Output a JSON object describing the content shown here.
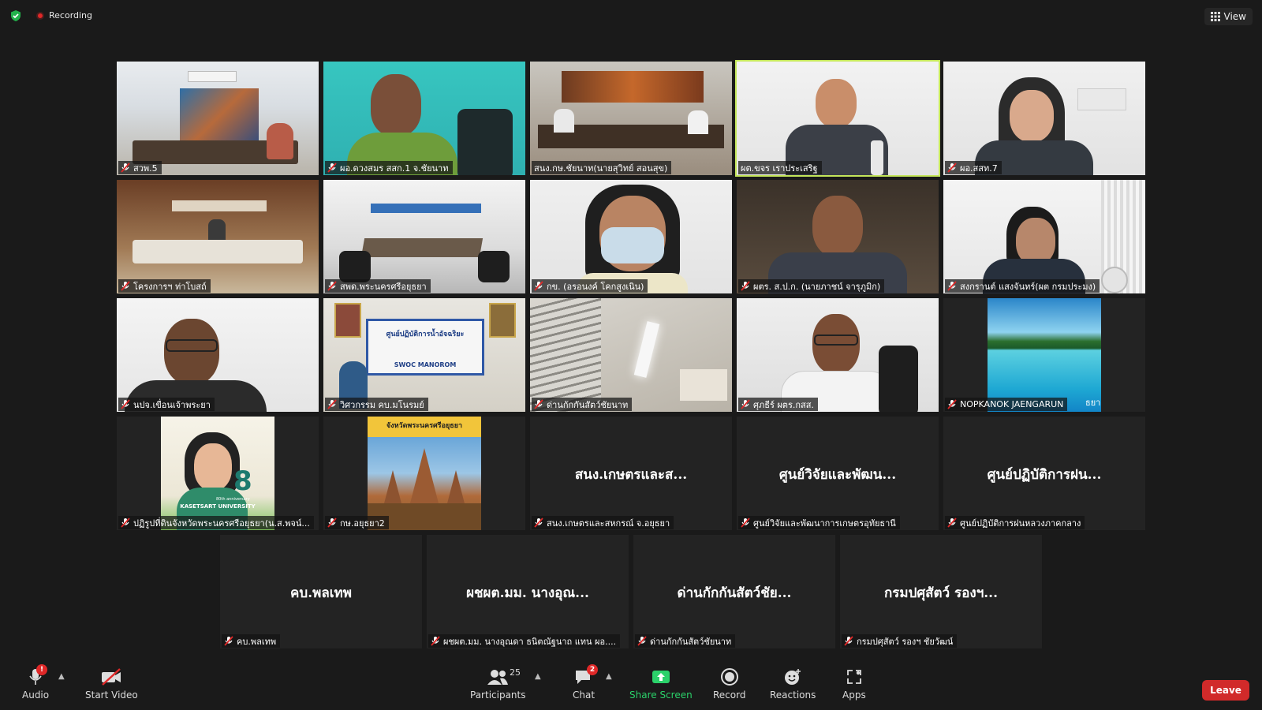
{
  "topbar": {
    "recording_label": "Recording",
    "view_label": "View"
  },
  "participants": [
    {
      "name": "สวพ.5",
      "video": true,
      "active": false
    },
    {
      "name": "ผอ.ดวงสมร สสก.1 จ.ชัยนาท",
      "video": true,
      "active": false
    },
    {
      "name": "สนง.กษ.ชัยนาท(นายสุวิทย์ สอนสุข)",
      "video": true,
      "active": false
    },
    {
      "name": "ผต.ขจร เราประเสริฐ",
      "video": true,
      "active": true
    },
    {
      "name": "ผอ.สสท.7",
      "video": true,
      "active": false
    },
    {
      "name": "โครงการฯ ท่าโบสถ์",
      "video": true,
      "active": false
    },
    {
      "name": "สพด.พระนครศรีอยุธยา",
      "video": true,
      "active": false
    },
    {
      "name": "กข. (อรอนงค์ โคกสูงเนิน)",
      "video": true,
      "active": false
    },
    {
      "name": "ผตร. ส.ป.ก. (นายภาชน์ จารุภูมิก)",
      "video": true,
      "active": false
    },
    {
      "name": "สงกรานต์ แสงจันทร์(ผต กรมประมง)",
      "video": true,
      "active": false
    },
    {
      "name": "นปจ.เขื่อนเจ้าพระยา",
      "video": true,
      "active": false
    },
    {
      "name": "วิศวกรรม คบ.มโนรมย์",
      "video": true,
      "active": false
    },
    {
      "name": "ด่านกักกันสัตว์ชัยนาท",
      "video": true,
      "active": false
    },
    {
      "name": "ศุภธีร์ ผตร.กสส.",
      "video": true,
      "active": false
    },
    {
      "name": "NOPKANOK JAENGARUN",
      "video": true,
      "active": false
    },
    {
      "name": "ปฏิรูปที่ดินจังหวัดพระนครศรีอยุธยา(น.ส.พจน์...",
      "video": true,
      "active": false
    },
    {
      "name": "กษ.อยุธยา2",
      "video": true,
      "active": false
    },
    {
      "name": "สนง.เกษตรและสหกรณ์ จ.อยุธยา",
      "big": "สนง.เกษตรและส...",
      "video": false,
      "active": false
    },
    {
      "name": "ศูนย์วิจัยและพัฒนาการเกษตรอุทัยธานี",
      "big": "ศูนย์วิจัยและพัฒน...",
      "video": false,
      "active": false
    },
    {
      "name": "ศูนย์ปฏิบัติการฝนหลวงภาคกลาง",
      "big": "ศูนย์ปฏิบัติการฝน...",
      "video": false,
      "active": false
    },
    {
      "name": "คบ.พลเทพ",
      "big": "คบ.พลเทพ",
      "video": false,
      "active": false
    },
    {
      "name": "ผชผต.มม. นางอุณดา ธนิตณัฐนาถ แทน ผอ....",
      "big": "ผชผต.มม. นางอุณ...",
      "video": false,
      "active": false
    },
    {
      "name": "ด่านกักกันสัตว์ชัยนาท",
      "big": "ด่านกักกันสัตว์ชัย...",
      "video": false,
      "active": false
    },
    {
      "name": "กรมปศุสัตว์ รองฯ ชัยวัฒน์",
      "big": "กรมปศุสัตว์ รองฯ...",
      "video": false,
      "active": false
    }
  ],
  "tile_text": {
    "banner_ayutthaya": "จังหวัดพระนครศรีอยุธยา",
    "swoc_title": "ศูนย์ปฏิบัติการน้ำอัจฉริยะ",
    "swoc_sub": "SWOC MANOROM",
    "ku_line1": "KASETSART UNIVERSITY",
    "ku_line2": "80th anniversary",
    "nopkanok_suffix": "ธยา"
  },
  "toolbar": {
    "audio": "Audio",
    "audio_badge": "!",
    "start_video": "Start Video",
    "participants": "Participants",
    "participants_count": "25",
    "chat": "Chat",
    "chat_badge": "2",
    "share_screen": "Share Screen",
    "record": "Record",
    "reactions": "Reactions",
    "apps": "Apps",
    "leave": "Leave"
  },
  "colors": {
    "active_speaker": "#c4e65a",
    "leave_button": "#d12a2a",
    "share_green": "#2bd16a",
    "muted_red": "#e02828"
  }
}
